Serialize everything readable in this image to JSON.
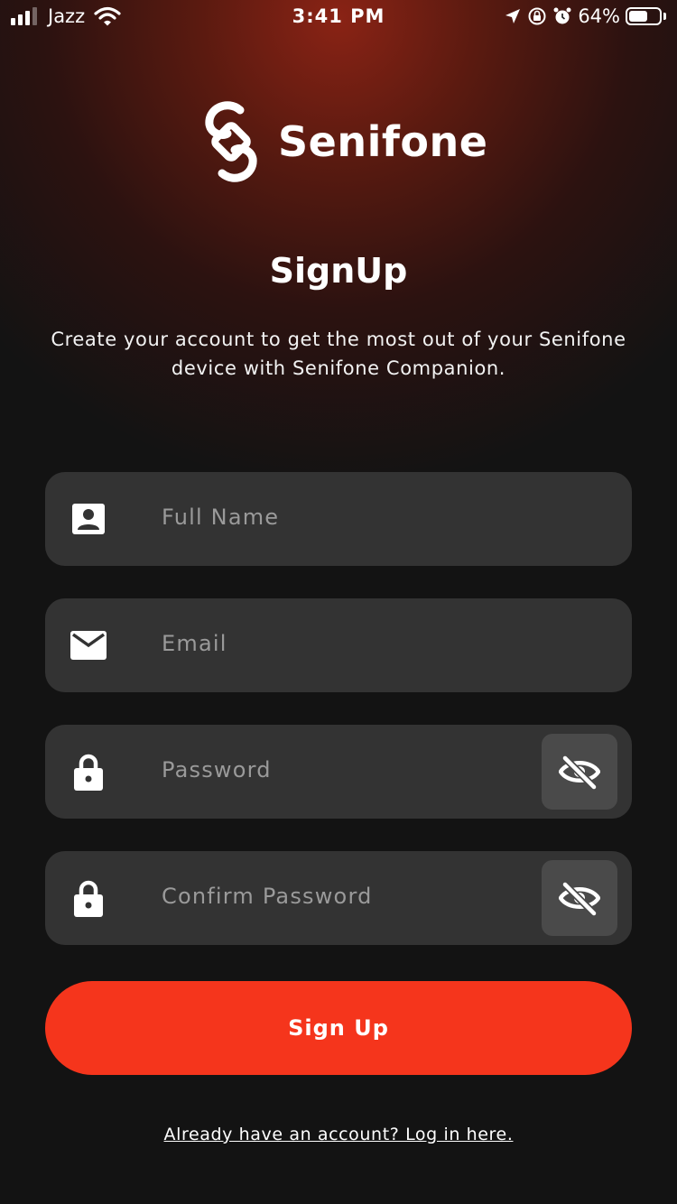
{
  "status_bar": {
    "carrier": "Jazz",
    "time": "3:41 PM",
    "battery_percent": "64%",
    "battery_level": 0.64,
    "signal_bars": 3
  },
  "brand": {
    "name": "Senifone",
    "logo_icon": "senifone-logo-icon"
  },
  "header": {
    "title": "SignUp",
    "subtitle": "Create your account to get the most out of your Senifone device with Senifone Companion."
  },
  "form": {
    "full_name": {
      "placeholder": "Full Name",
      "value": "",
      "icon": "contact-card-icon"
    },
    "email": {
      "placeholder": "Email",
      "value": "",
      "icon": "envelope-icon"
    },
    "password": {
      "placeholder": "Password",
      "value": "",
      "icon": "lock-icon",
      "toggle_icon": "eye-off-icon"
    },
    "confirm_password": {
      "placeholder": "Confirm Password",
      "value": "",
      "icon": "lock-icon",
      "toggle_icon": "eye-off-icon"
    }
  },
  "actions": {
    "signup_label": "Sign Up",
    "login_link": "Already have an account? Log in here."
  },
  "colors": {
    "accent": "#f5351c",
    "background": "#131313",
    "field": "#333333",
    "glow": "#8a2315"
  }
}
